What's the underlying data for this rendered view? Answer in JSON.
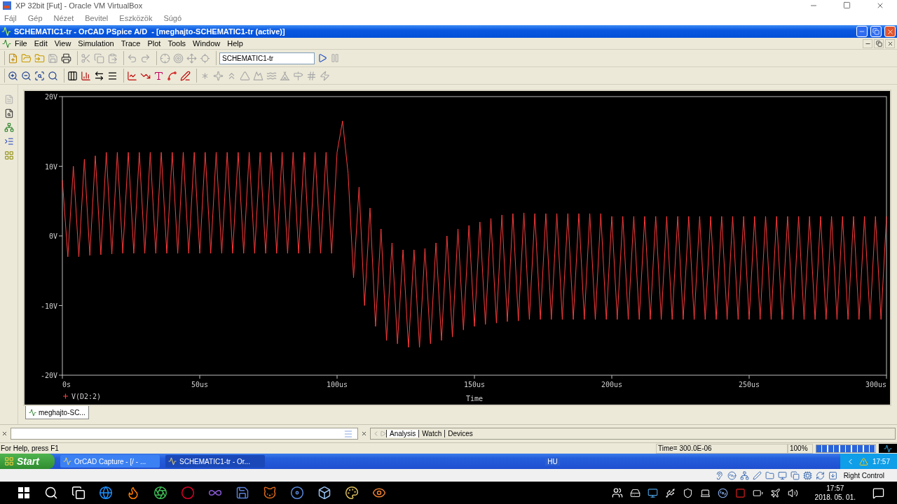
{
  "host_window": {
    "title": "XP 32bit [Fut] - Oracle VM VirtualBox",
    "menu": [
      "Fájl",
      "Gép",
      "Nézet",
      "Bevitel",
      "Eszközök",
      "Súgó"
    ]
  },
  "app_window": {
    "title": "SCHEMATIC1-tr - OrCAD PSpice A/D  - [meghajto-SCHEMATIC1-tr (active)]",
    "menu": [
      "File",
      "Edit",
      "View",
      "Simulation",
      "Trace",
      "Plot",
      "Tools",
      "Window",
      "Help"
    ]
  },
  "toolbars": [
    {
      "groups": [
        {
          "buttons": [
            {
              "disabled": false
            },
            {
              "disabled": false
            },
            {
              "disabled": false
            },
            {
              "disabled": true
            },
            {
              "disabled": false
            }
          ]
        },
        {
          "buttons": [
            {
              "disabled": true
            },
            {
              "disabled": true
            },
            {
              "disabled": true
            }
          ]
        },
        {
          "buttons": [
            {
              "disabled": true
            },
            {
              "disabled": true
            }
          ]
        },
        {
          "buttons": [
            {
              "disabled": true
            },
            {
              "disabled": true
            },
            {
              "disabled": true
            },
            {
              "disabled": true
            }
          ]
        }
      ],
      "profile": "SCHEMATIC1-tr",
      "run": {
        "disabled": false
      },
      "pause": {
        "disabled": true
      }
    },
    {
      "groups": [
        {
          "buttons": [
            {
              "disabled": false
            },
            {
              "disabled": false
            },
            {
              "disabled": false
            },
            {
              "disabled": false
            }
          ]
        },
        {
          "buttons": [
            {
              "disabled": false
            },
            {
              "disabled": false
            },
            {
              "disabled": false
            },
            {
              "disabled": false
            }
          ]
        },
        {
          "buttons": [
            {
              "disabled": false
            },
            {
              "disabled": false
            },
            {
              "disabled": false
            },
            {
              "disabled": false
            },
            {
              "disabled": false
            }
          ]
        },
        {
          "buttons": [
            {
              "disabled": true
            },
            {
              "disabled": true
            },
            {
              "disabled": true
            },
            {
              "disabled": true
            },
            {
              "disabled": true
            },
            {
              "disabled": true
            },
            {
              "disabled": true
            },
            {
              "disabled": true
            },
            {
              "disabled": true
            },
            {
              "disabled": true
            }
          ]
        }
      ]
    }
  ],
  "side_toolbar": [
    {
      "disabled": true
    },
    {
      "disabled": false
    },
    {
      "disabled": false
    },
    {
      "disabled": false
    },
    {
      "disabled": false
    }
  ],
  "plot": {
    "chart_data": {
      "type": "line",
      "xlabel": "Time",
      "xlim": [
        0,
        300
      ],
      "ylim": [
        -20,
        20
      ],
      "xticks": [
        {
          "value": 0,
          "label": "0s"
        },
        {
          "value": 50,
          "label": "50us"
        },
        {
          "value": 100,
          "label": "100us"
        },
        {
          "value": 150,
          "label": "150us"
        },
        {
          "value": 200,
          "label": "200us"
        },
        {
          "value": 250,
          "label": "250us"
        },
        {
          "value": 300,
          "label": "300us"
        }
      ],
      "yticks": [
        {
          "value": 20,
          "label": "20V"
        },
        {
          "value": 10,
          "label": "10V"
        },
        {
          "value": 0,
          "label": "0V"
        },
        {
          "value": -10,
          "label": "-10V"
        },
        {
          "value": -20,
          "label": "-20V"
        }
      ],
      "x": [
        0,
        2,
        4,
        6,
        8,
        10,
        12,
        14,
        16,
        18,
        20,
        22,
        24,
        26,
        28,
        30,
        32,
        34,
        36,
        38,
        40,
        42,
        44,
        46,
        48,
        50,
        52,
        54,
        56,
        58,
        60,
        62,
        64,
        66,
        68,
        70,
        72,
        74,
        76,
        78,
        80,
        82,
        84,
        86,
        88,
        90,
        92,
        94,
        96,
        98,
        100,
        102,
        104,
        106,
        108,
        110,
        112,
        114,
        116,
        118,
        120,
        122,
        124,
        126,
        128,
        130,
        132,
        134,
        136,
        138,
        140,
        142,
        144,
        146,
        148,
        150,
        152,
        154,
        156,
        158,
        160,
        162,
        164,
        166,
        168,
        170,
        172,
        174,
        176,
        178,
        180,
        182,
        184,
        186,
        188,
        190,
        192,
        194,
        196,
        198,
        200,
        202,
        204,
        206,
        208,
        210,
        212,
        214,
        216,
        218,
        220,
        222,
        224,
        226,
        228,
        230,
        232,
        234,
        236,
        238,
        240,
        242,
        244,
        246,
        248,
        250,
        252,
        254,
        256,
        258,
        260,
        262,
        264,
        266,
        268,
        270,
        272,
        274,
        276,
        278,
        280,
        282,
        284,
        286,
        288,
        290,
        292,
        294,
        296,
        298,
        300
      ],
      "series": [
        {
          "name": "V(D2:2)",
          "color": "#ff3c3c",
          "values": [
            8,
            -3,
            10,
            -3,
            11,
            -2.8,
            11.5,
            -2.7,
            12,
            -2.6,
            12,
            -2.5,
            12,
            -2.5,
            12,
            -2.5,
            12,
            -2.5,
            12,
            -2.5,
            12,
            -2.5,
            12,
            -2.5,
            12,
            -2.5,
            12,
            -2.5,
            12,
            -2.5,
            12,
            -2.5,
            12,
            -2.5,
            12,
            -2.5,
            12,
            -2.5,
            12,
            -2.5,
            12,
            -2.5,
            12,
            -2.5,
            12,
            -2.5,
            12,
            -2.5,
            12,
            -2.5,
            12,
            16.5,
            9,
            -6,
            7,
            -10,
            4,
            -13,
            1,
            -15,
            -1,
            -15.5,
            -2,
            -16,
            -2,
            -16,
            -1.8,
            -15.5,
            -1,
            -15,
            0,
            -14.5,
            1,
            -13.5,
            1.5,
            -13,
            2,
            -12.7,
            2.5,
            -12.5,
            3,
            -12.3,
            3.2,
            -12.2,
            3.3,
            -12,
            3.2,
            -12,
            3.2,
            -12,
            3.2,
            -12,
            3.2,
            -12,
            3.2,
            -12,
            3.2,
            -12,
            3.2,
            -12,
            2.8,
            -12,
            2.8,
            -12,
            2.8,
            -12,
            2.8,
            -12,
            2.8,
            -12,
            2.8,
            -12,
            2.8,
            -12,
            2.8,
            -12,
            2.8,
            -12,
            2.8,
            -12,
            2.8,
            -12,
            2.8,
            -12,
            2.8,
            -12,
            2.8,
            -12,
            2.8,
            -12,
            2.8,
            -12,
            2.8,
            -12,
            2.8,
            -12,
            2.8,
            -12,
            2.8,
            -12,
            2.8,
            -12,
            2.8,
            -12,
            2.8,
            -12,
            2.8,
            -12,
            2.8,
            -12,
            2.8
          ]
        }
      ]
    }
  },
  "document_tabs": [
    {
      "label": "meghajto-SC...",
      "selected": true
    }
  ],
  "output": {
    "tabs": [
      {
        "label": "Analysis",
        "selected": true
      },
      {
        "label": "Watch",
        "selected": false
      },
      {
        "label": "Devices",
        "selected": false
      }
    ]
  },
  "status_bar": {
    "help": "For Help, press F1",
    "time": "Time= 300.0E-06",
    "zoom": "100%",
    "progress": {
      "level": 1
    }
  },
  "xp_taskbar": {
    "start": "Start",
    "tasks": [
      {
        "label": "OrCAD Capture - [/ - ...",
        "selected": false
      },
      {
        "label": "SCHEMATIC1-tr - Or...",
        "selected": true
      }
    ],
    "language": "HU",
    "clock": "17:57"
  },
  "vbox_status": {
    "host_key": "Right Control"
  },
  "win_taskbar": {
    "time": "17:57",
    "date": "2018. 05. 01."
  }
}
